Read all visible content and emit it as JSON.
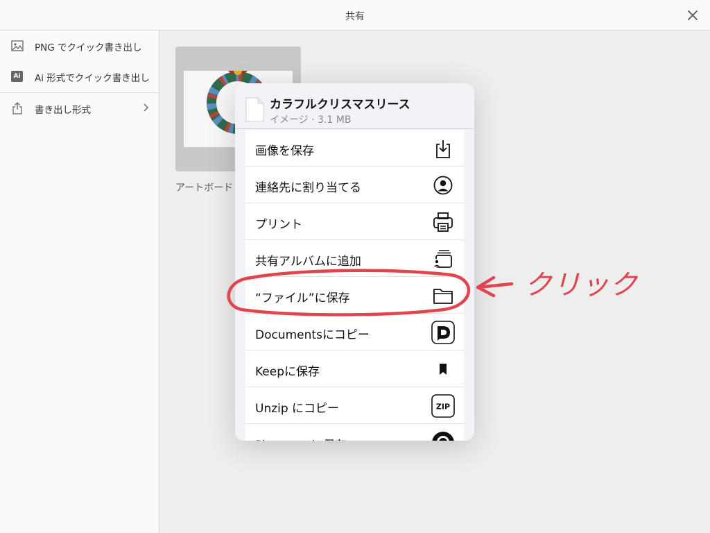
{
  "header": {
    "title": "共有",
    "close_icon": "close-icon"
  },
  "sidebar": {
    "items": [
      {
        "label": "PNG でクイック書き出し",
        "icon": "image-icon"
      },
      {
        "label": "Ai 形式でクイック書き出し",
        "icon": "ai-badge-icon",
        "badge": "Ai"
      },
      {
        "label": "書き出し形式",
        "icon": "share-icon",
        "chevron": "chevron-right-icon"
      }
    ]
  },
  "main": {
    "artboard_caption": "アートボード"
  },
  "share_sheet": {
    "title": "カラフルクリスマスリース",
    "subtitle": "イメージ · 3.1 MB",
    "actions": [
      {
        "label": "画像を保存",
        "icon": "save-image-icon"
      },
      {
        "label": "連絡先に割り当てる",
        "icon": "contact-icon"
      },
      {
        "label": "プリント",
        "icon": "printer-icon"
      },
      {
        "label": "共有アルバムに追加",
        "icon": "shared-album-icon"
      },
      {
        "label": "“ファイル”に保存",
        "icon": "folder-icon"
      },
      {
        "label": "Documentsにコピー",
        "icon": "documents-app-icon"
      },
      {
        "label": "Keepに保存",
        "icon": "bookmark-icon"
      },
      {
        "label": "Unzip にコピー",
        "icon": "zip-icon",
        "icon_text": "ZIP"
      },
      {
        "label": "Pinterest に保存",
        "icon": "pinterest-icon"
      }
    ]
  },
  "annotation": {
    "text": "クリック",
    "color": "#e0454e"
  }
}
